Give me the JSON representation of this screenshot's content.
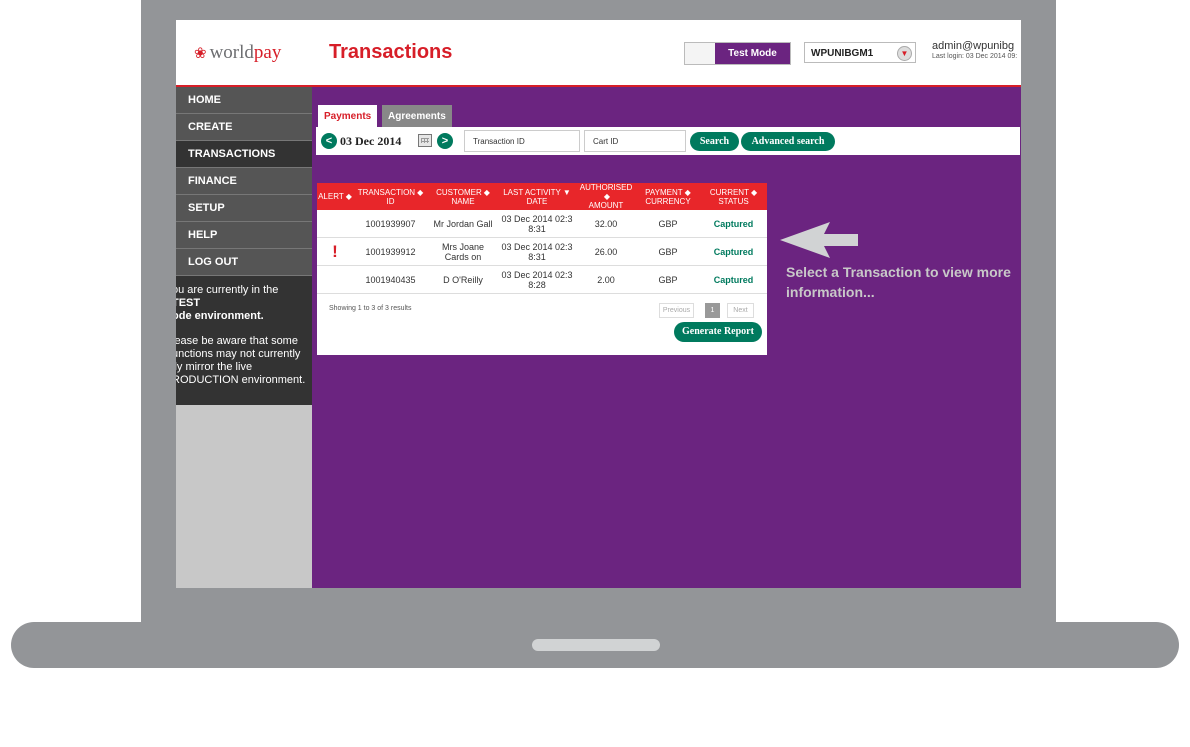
{
  "header": {
    "logo_prefix": "world",
    "logo_accent": "pay",
    "page_title": "Transactions",
    "mode_label": "Test Mode",
    "merchant_code": "WPUNIBGM1",
    "user": "admin@wpunibg",
    "last_login": "Last login: 03 Dec 2014 09:"
  },
  "sidebar": {
    "items": [
      {
        "label": "HOME"
      },
      {
        "label": "CREATE"
      },
      {
        "label": "TRANSACTIONS"
      },
      {
        "label": "FINANCE"
      },
      {
        "label": "SETUP"
      },
      {
        "label": "HELP"
      },
      {
        "label": "LOG OUT"
      }
    ],
    "active": "TRANSACTIONS",
    "notice_1_text": "ou are currently in the ",
    "notice_1_strong_a": "TEST",
    "notice_1_strong_b": "ode environment.",
    "notice_2_line1": "lease be aware that some",
    "notice_2_line2": "unctions may not currently",
    "notice_2_line3": "lly mirror the live",
    "notice_2_line4": "RODUCTION environment."
  },
  "tabs": [
    {
      "label": "Payments",
      "active": true
    },
    {
      "label": "Agreements",
      "active": false
    }
  ],
  "toolbar": {
    "prev_label": "<",
    "next_label": ">",
    "date": "03 Dec 2014",
    "transaction_id_placeholder": "Transaction ID",
    "cart_id_placeholder": "Cart ID",
    "search_label": "Search",
    "advanced_search_label": "Advanced search"
  },
  "table": {
    "columns": [
      {
        "line1": "ALERT",
        "line2": ""
      },
      {
        "line1": "TRANSACTION",
        "line2": "ID"
      },
      {
        "line1": "CUSTOMER",
        "line2": "NAME"
      },
      {
        "line1": "LAST ACTIVITY",
        "line2": "DATE"
      },
      {
        "line1": "AUTHORISED",
        "line2": "AMOUNT"
      },
      {
        "line1": "PAYMENT",
        "line2": "CURRENCY"
      },
      {
        "line1": "CURRENT",
        "line2": "STATUS"
      }
    ],
    "rows": [
      {
        "alert": "",
        "id": "1001939907",
        "name": "Mr Jordan Gall",
        "date": "03 Dec 2014 02:3 8:31",
        "amount": "32.00",
        "currency": "GBP",
        "status": "Captured"
      },
      {
        "alert": "!",
        "id": "1001939912",
        "name": "Mrs Joane Cards on",
        "date": "03 Dec 2014 02:3 8:31",
        "amount": "26.00",
        "currency": "GBP",
        "status": "Captured"
      },
      {
        "alert": "",
        "id": "1001940435",
        "name": "D O'Reilly",
        "date": "03 Dec 2014 02:3 8:28",
        "amount": "2.00",
        "currency": "GBP",
        "status": "Captured"
      }
    ],
    "summary": "Showing 1 to 3 of 3 results",
    "previous_label": "Previous",
    "page_label": "1",
    "next_label": "Next",
    "report_label": "Generate Report"
  },
  "hint": "Select a Transaction to view more information...",
  "colors": {
    "brand_red": "#d71e28",
    "purple": "#6b2480",
    "green": "#007a5e",
    "laptop_gray": "#939598"
  },
  "icons": [
    "worldpay-logo-icon",
    "chevron-down-icon",
    "calendar-icon",
    "sort-arrows-icon",
    "alert-icon",
    "pointing-arrow-icon"
  ]
}
